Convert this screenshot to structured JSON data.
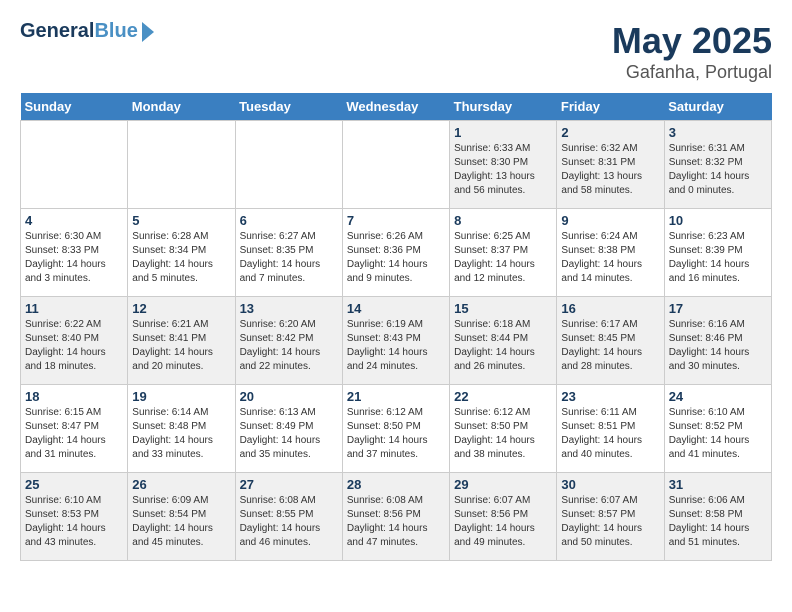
{
  "logo": {
    "line1": "General",
    "line2": "Blue"
  },
  "title": "May 2025",
  "subtitle": "Gafanha, Portugal",
  "days_of_week": [
    "Sunday",
    "Monday",
    "Tuesday",
    "Wednesday",
    "Thursday",
    "Friday",
    "Saturday"
  ],
  "weeks": [
    [
      {
        "num": "",
        "info": ""
      },
      {
        "num": "",
        "info": ""
      },
      {
        "num": "",
        "info": ""
      },
      {
        "num": "",
        "info": ""
      },
      {
        "num": "1",
        "info": "Sunrise: 6:33 AM\nSunset: 8:30 PM\nDaylight: 13 hours\nand 56 minutes."
      },
      {
        "num": "2",
        "info": "Sunrise: 6:32 AM\nSunset: 8:31 PM\nDaylight: 13 hours\nand 58 minutes."
      },
      {
        "num": "3",
        "info": "Sunrise: 6:31 AM\nSunset: 8:32 PM\nDaylight: 14 hours\nand 0 minutes."
      }
    ],
    [
      {
        "num": "4",
        "info": "Sunrise: 6:30 AM\nSunset: 8:33 PM\nDaylight: 14 hours\nand 3 minutes."
      },
      {
        "num": "5",
        "info": "Sunrise: 6:28 AM\nSunset: 8:34 PM\nDaylight: 14 hours\nand 5 minutes."
      },
      {
        "num": "6",
        "info": "Sunrise: 6:27 AM\nSunset: 8:35 PM\nDaylight: 14 hours\nand 7 minutes."
      },
      {
        "num": "7",
        "info": "Sunrise: 6:26 AM\nSunset: 8:36 PM\nDaylight: 14 hours\nand 9 minutes."
      },
      {
        "num": "8",
        "info": "Sunrise: 6:25 AM\nSunset: 8:37 PM\nDaylight: 14 hours\nand 12 minutes."
      },
      {
        "num": "9",
        "info": "Sunrise: 6:24 AM\nSunset: 8:38 PM\nDaylight: 14 hours\nand 14 minutes."
      },
      {
        "num": "10",
        "info": "Sunrise: 6:23 AM\nSunset: 8:39 PM\nDaylight: 14 hours\nand 16 minutes."
      }
    ],
    [
      {
        "num": "11",
        "info": "Sunrise: 6:22 AM\nSunset: 8:40 PM\nDaylight: 14 hours\nand 18 minutes."
      },
      {
        "num": "12",
        "info": "Sunrise: 6:21 AM\nSunset: 8:41 PM\nDaylight: 14 hours\nand 20 minutes."
      },
      {
        "num": "13",
        "info": "Sunrise: 6:20 AM\nSunset: 8:42 PM\nDaylight: 14 hours\nand 22 minutes."
      },
      {
        "num": "14",
        "info": "Sunrise: 6:19 AM\nSunset: 8:43 PM\nDaylight: 14 hours\nand 24 minutes."
      },
      {
        "num": "15",
        "info": "Sunrise: 6:18 AM\nSunset: 8:44 PM\nDaylight: 14 hours\nand 26 minutes."
      },
      {
        "num": "16",
        "info": "Sunrise: 6:17 AM\nSunset: 8:45 PM\nDaylight: 14 hours\nand 28 minutes."
      },
      {
        "num": "17",
        "info": "Sunrise: 6:16 AM\nSunset: 8:46 PM\nDaylight: 14 hours\nand 30 minutes."
      }
    ],
    [
      {
        "num": "18",
        "info": "Sunrise: 6:15 AM\nSunset: 8:47 PM\nDaylight: 14 hours\nand 31 minutes."
      },
      {
        "num": "19",
        "info": "Sunrise: 6:14 AM\nSunset: 8:48 PM\nDaylight: 14 hours\nand 33 minutes."
      },
      {
        "num": "20",
        "info": "Sunrise: 6:13 AM\nSunset: 8:49 PM\nDaylight: 14 hours\nand 35 minutes."
      },
      {
        "num": "21",
        "info": "Sunrise: 6:12 AM\nSunset: 8:50 PM\nDaylight: 14 hours\nand 37 minutes."
      },
      {
        "num": "22",
        "info": "Sunrise: 6:12 AM\nSunset: 8:50 PM\nDaylight: 14 hours\nand 38 minutes."
      },
      {
        "num": "23",
        "info": "Sunrise: 6:11 AM\nSunset: 8:51 PM\nDaylight: 14 hours\nand 40 minutes."
      },
      {
        "num": "24",
        "info": "Sunrise: 6:10 AM\nSunset: 8:52 PM\nDaylight: 14 hours\nand 41 minutes."
      }
    ],
    [
      {
        "num": "25",
        "info": "Sunrise: 6:10 AM\nSunset: 8:53 PM\nDaylight: 14 hours\nand 43 minutes."
      },
      {
        "num": "26",
        "info": "Sunrise: 6:09 AM\nSunset: 8:54 PM\nDaylight: 14 hours\nand 45 minutes."
      },
      {
        "num": "27",
        "info": "Sunrise: 6:08 AM\nSunset: 8:55 PM\nDaylight: 14 hours\nand 46 minutes."
      },
      {
        "num": "28",
        "info": "Sunrise: 6:08 AM\nSunset: 8:56 PM\nDaylight: 14 hours\nand 47 minutes."
      },
      {
        "num": "29",
        "info": "Sunrise: 6:07 AM\nSunset: 8:56 PM\nDaylight: 14 hours\nand 49 minutes."
      },
      {
        "num": "30",
        "info": "Sunrise: 6:07 AM\nSunset: 8:57 PM\nDaylight: 14 hours\nand 50 minutes."
      },
      {
        "num": "31",
        "info": "Sunrise: 6:06 AM\nSunset: 8:58 PM\nDaylight: 14 hours\nand 51 minutes."
      }
    ]
  ]
}
